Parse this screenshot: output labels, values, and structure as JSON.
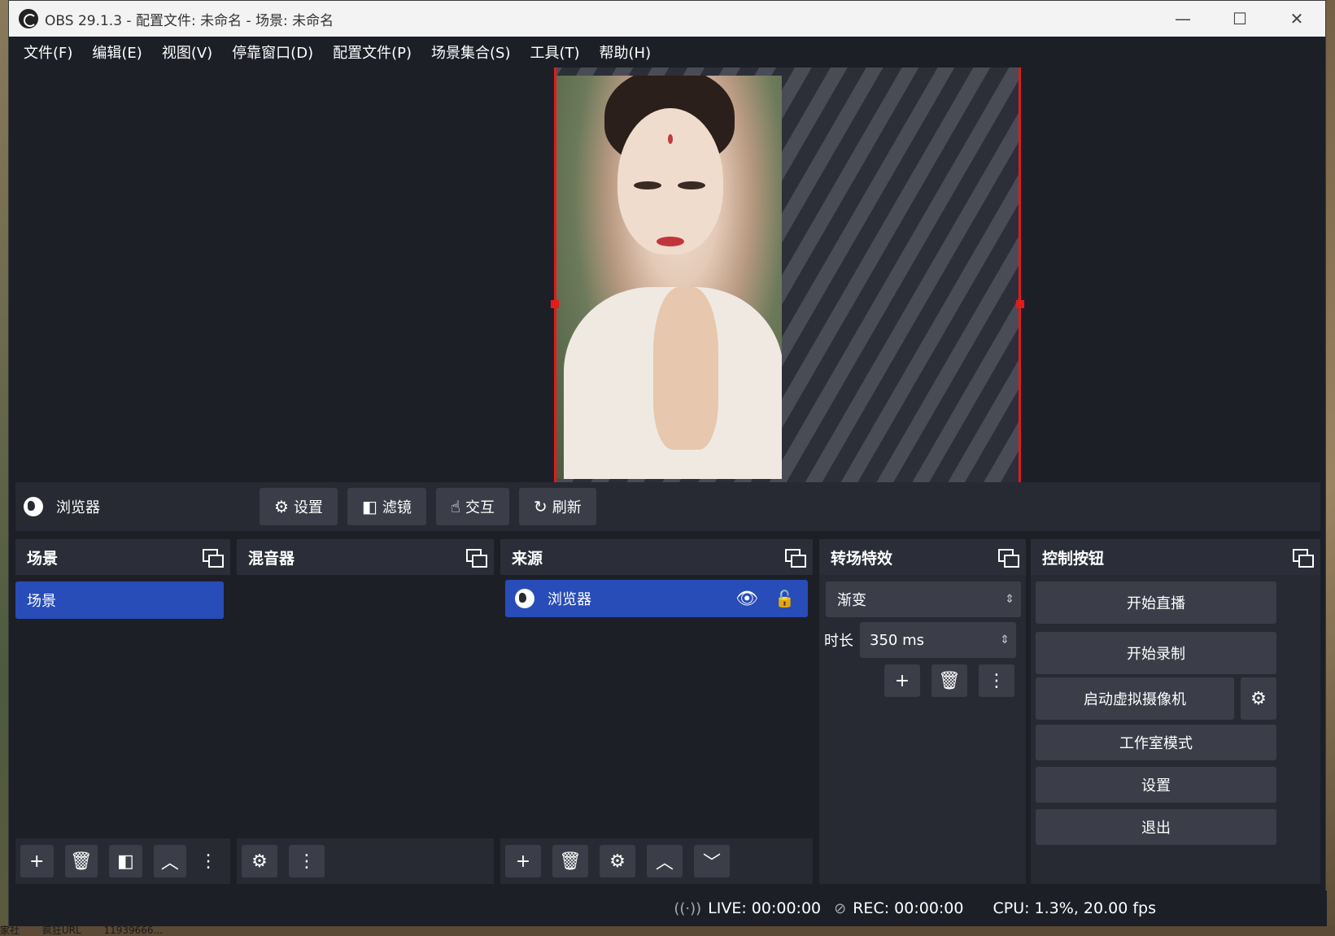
{
  "window": {
    "title": "OBS 29.1.3 - 配置文件: 未命名 - 场景: 未命名"
  },
  "menu": [
    "文件(F)",
    "编辑(E)",
    "视图(V)",
    "停靠窗口(D)",
    "配置文件(P)",
    "场景集合(S)",
    "工具(T)",
    "帮助(H)"
  ],
  "source_toolbar": {
    "source_name": "浏览器",
    "settings": "设置",
    "filters": "滤镜",
    "interact": "交互",
    "refresh": "刷新"
  },
  "scenes": {
    "title": "场景",
    "items": [
      "场景"
    ]
  },
  "mixer": {
    "title": "混音器"
  },
  "sources": {
    "title": "来源",
    "items": [
      "浏览器"
    ]
  },
  "transitions": {
    "title": "转场特效",
    "selected": "渐变",
    "duration_label": "时长",
    "duration_value": "350 ms"
  },
  "controls": {
    "title": "控制按钮",
    "start_stream": "开始直播",
    "start_record": "开始录制",
    "virtual_cam": "启动虚拟摄像机",
    "studio_mode": "工作室模式",
    "settings": "设置",
    "exit": "退出"
  },
  "status": {
    "live": "LIVE: 00:00:00",
    "rec": "REC: 00:00:00",
    "cpu": "CPU: 1.3%, 20.00 fps"
  },
  "desktop": {
    "taskbar_fragments": [
      "家社",
      "疯狂URL",
      "11939666..."
    ]
  },
  "colors": {
    "selection": "#284cb8",
    "bounds": "#e21b1b",
    "panel": "#272a33",
    "background": "#1d1f27"
  }
}
